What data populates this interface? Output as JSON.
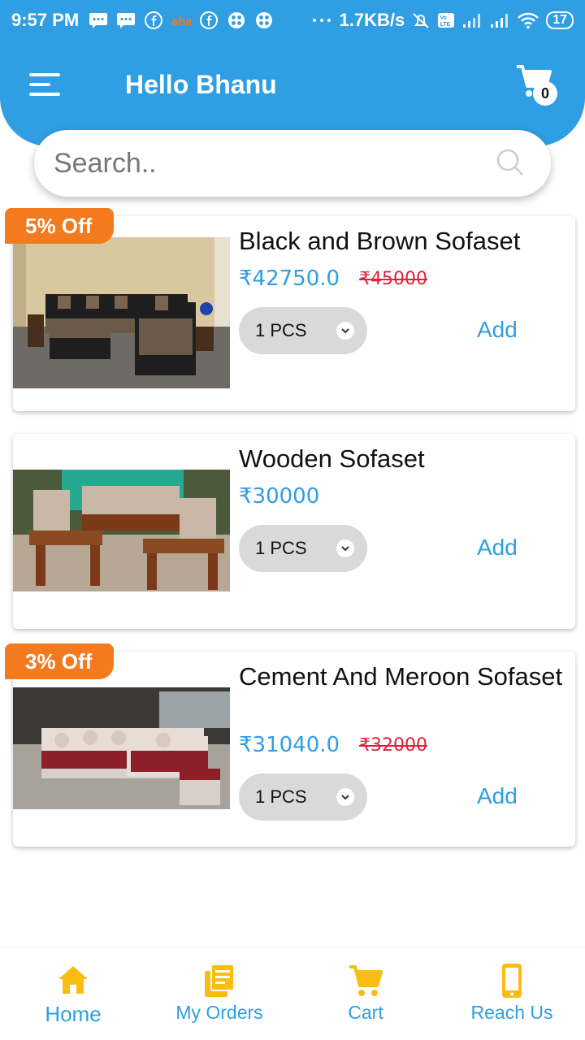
{
  "status_bar": {
    "time": "9:57 PM",
    "speed": "1.7KB/s",
    "battery": "17"
  },
  "header": {
    "greeting": "Hello Bhanu",
    "cart_count": "0"
  },
  "search": {
    "placeholder": "Search.."
  },
  "products": [
    {
      "name": "Black and Brown Sofaset",
      "price": "₹42750.0",
      "mrp": "₹45000",
      "quantity": "1 PCS",
      "add_label": "Add",
      "discount": "5% Off"
    },
    {
      "name": "Wooden Sofaset",
      "price": "₹30000",
      "mrp": "",
      "quantity": "1 PCS",
      "add_label": "Add",
      "discount": ""
    },
    {
      "name": "Cement And Meroon Sofaset",
      "price": "₹31040.0",
      "mrp": "₹32000",
      "quantity": "1 PCS",
      "add_label": "Add",
      "discount": "3% Off"
    }
  ],
  "bottom_nav": [
    {
      "label": "Home",
      "icon": "home-icon",
      "active": true
    },
    {
      "label": "My Orders",
      "icon": "orders-icon",
      "active": false
    },
    {
      "label": "Cart",
      "icon": "cart-icon",
      "active": false
    },
    {
      "label": "Reach Us",
      "icon": "phone-icon",
      "active": false
    }
  ],
  "colors": {
    "primary": "#2f9ee2",
    "accent_orange": "#f37a1f",
    "icon_yellow": "#f9bd11",
    "strike_red": "#e3213c"
  }
}
